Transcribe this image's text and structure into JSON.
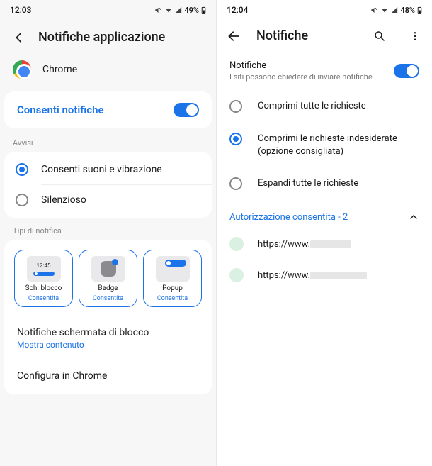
{
  "left": {
    "status": {
      "time": "12:03",
      "battery": "49%"
    },
    "title": "Notifiche applicazione",
    "app_name": "Chrome",
    "allow": {
      "label": "Consenti notifiche"
    },
    "avvisi_label": "Avvisi",
    "sound": {
      "label": "Consenti suoni e vibrazione"
    },
    "silent": {
      "label": "Silenzioso"
    },
    "tipi_label": "Tipi di notifica",
    "types": {
      "lock": {
        "title": "Sch. blocco",
        "status": "Consentita",
        "preview_time": "12:45"
      },
      "badge": {
        "title": "Badge",
        "status": "Consentita"
      },
      "popup": {
        "title": "Popup",
        "status": "Consentita"
      }
    },
    "lockscreen": {
      "title": "Notifiche schermata di blocco",
      "sub": "Mostra contenuto"
    },
    "configure": {
      "title": "Configura in Chrome"
    }
  },
  "right": {
    "status": {
      "time": "12:04",
      "battery": "48%"
    },
    "title": "Notifiche",
    "notif": {
      "title": "Notifiche",
      "sub": "I siti possono chiedere di inviare notifiche"
    },
    "opts": {
      "compress_all": "Comprimi tutte le richieste",
      "compress_unwanted": "Comprimi le richieste indesiderate (opzione consigliata)",
      "expand_all": "Espandi tutte le richieste"
    },
    "perm": {
      "label": "Autorizzazione consentita - 2"
    },
    "sites": {
      "s1": "https://www.",
      "s2": "https://www."
    }
  }
}
